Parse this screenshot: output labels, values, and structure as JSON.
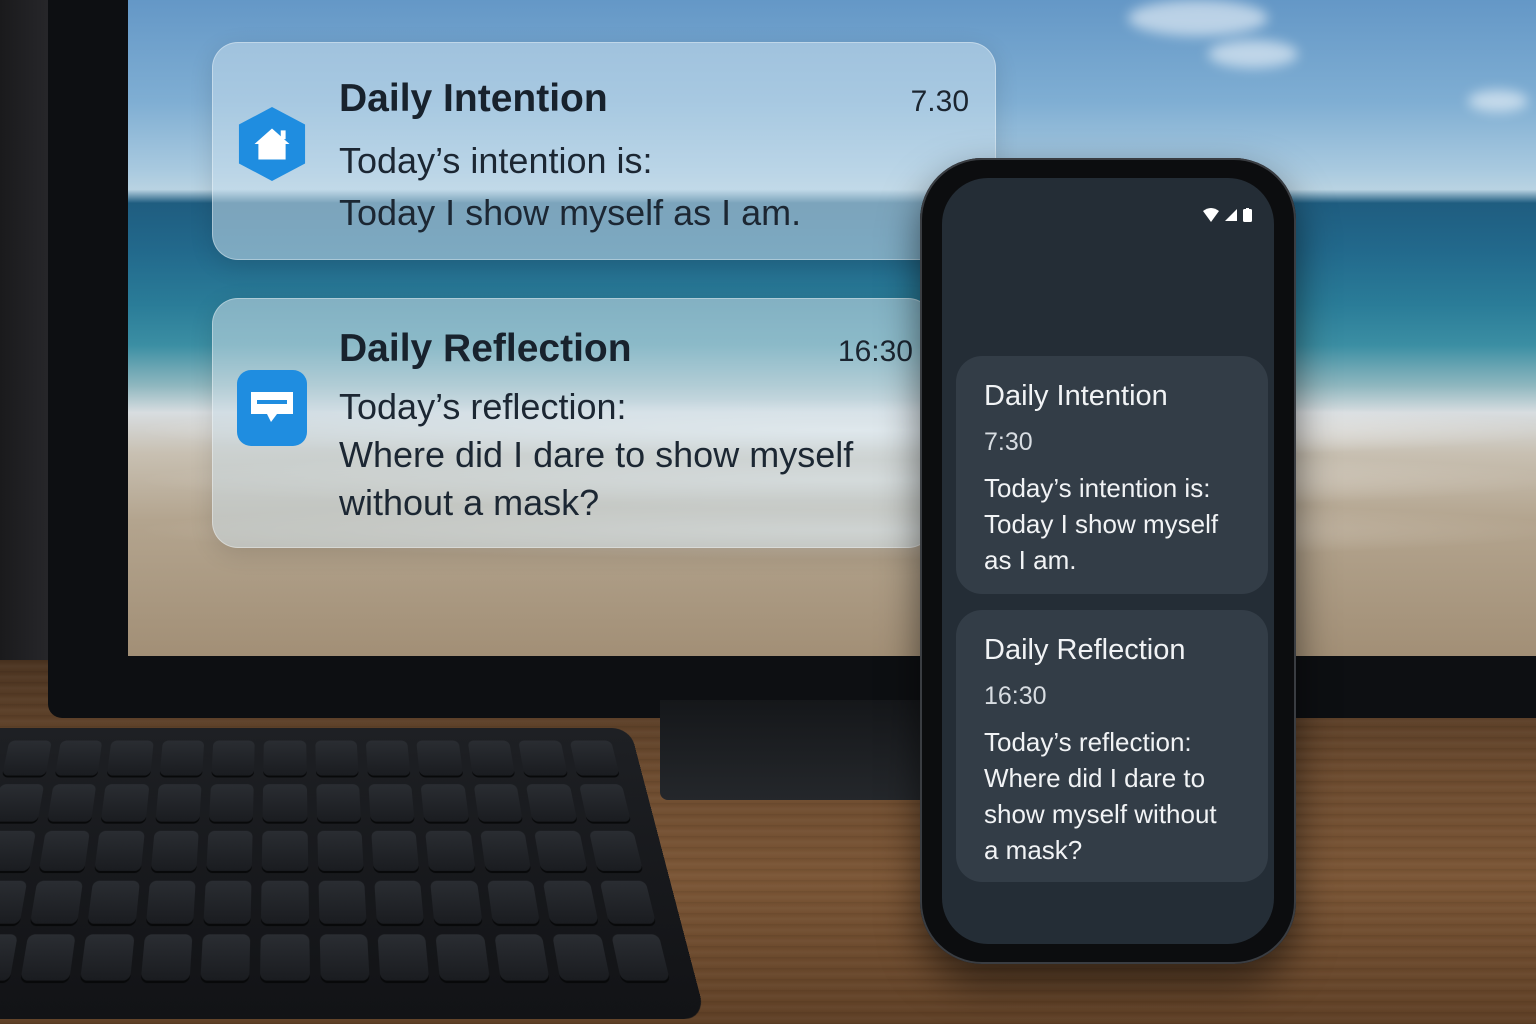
{
  "desktop_notifications": [
    {
      "title": "Daily Intention",
      "time": "7.30",
      "body": "Today’s intention is:\nToday I show myself as I am.",
      "icon": "home-icon",
      "icon_color": "#1f8de0"
    },
    {
      "title": "Daily Reflection",
      "time": "16:30",
      "body": "Today’s reflection:\nWhere did I dare to show myself\nwithout a mask?",
      "icon": "message-icon",
      "icon_color": "#1f8de0"
    }
  ],
  "phone": {
    "status_icons": [
      "wifi-icon",
      "signal-icon",
      "battery-icon"
    ],
    "notifications": [
      {
        "title": "Daily Intention",
        "time": "7:30",
        "body": "Today’s intention is:\nToday I show myself\nas I am."
      },
      {
        "title": "Daily Reflection",
        "time": "16:30",
        "body": "Today’s reflection:\nWhere did I dare to\nshow myself without\na mask?"
      }
    ]
  }
}
